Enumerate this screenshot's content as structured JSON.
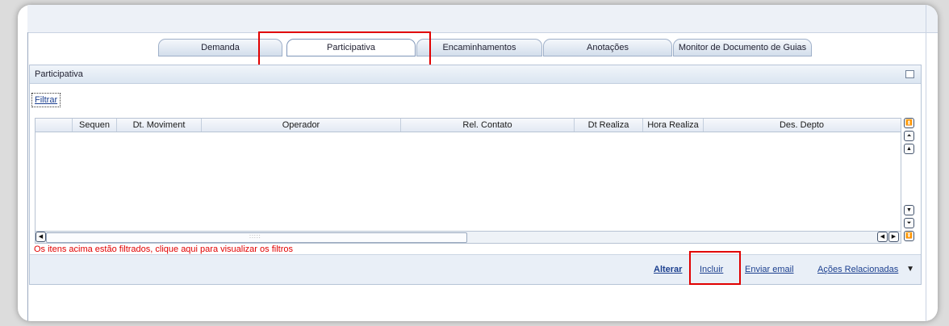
{
  "tabs": [
    {
      "label": "Demanda",
      "active": false
    },
    {
      "label": "Participativa",
      "active": true
    },
    {
      "label": "Encaminhamentos",
      "active": false
    },
    {
      "label": "Anotações",
      "active": false
    },
    {
      "label": "Monitor de Documento de Guias",
      "active": false
    }
  ],
  "panel": {
    "title": "Participativa",
    "filter_label": "Filtrar",
    "columns": [
      "Sequen",
      "Dt. Moviment",
      "Operador",
      "Rel. Contato",
      "Dt Realiza",
      "Hora Realiza",
      "Des. Depto"
    ],
    "rows": [],
    "filtered_message": "Os itens acima estão filtrados, clique aqui para visualizar os filtros"
  },
  "footer": {
    "alterar": "Alterar",
    "incluir": "Incluir",
    "enviar_email": "Enviar email",
    "acoes_relacionadas": "Ações Relacionadas",
    "dropdown_glyph": "▼"
  },
  "highlight_color": "#e10000"
}
